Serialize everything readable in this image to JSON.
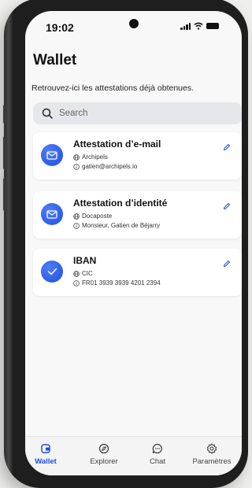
{
  "status_bar": {
    "time": "19:02"
  },
  "header": {
    "title": "Wallet",
    "subtitle": "Retrouvez-ici les attestations déjà obtenues."
  },
  "search": {
    "placeholder": "Search"
  },
  "cards": [
    {
      "title": "Attestation d’e-mail",
      "issuer": "Archipels",
      "detail": "gatien@archipels.io",
      "icon": "mail-icon"
    },
    {
      "title": "Attestation d’identité",
      "issuer": "Docaposte",
      "detail": "Monsieur, Gatien de Béjarry",
      "icon": "mail-icon"
    },
    {
      "title": "IBAN",
      "issuer": "CIC",
      "detail": "FR01 3939 3939 4201 2394",
      "icon": "check-icon"
    }
  ],
  "tabs": [
    {
      "label": "Wallet",
      "icon": "wallet-icon",
      "active": true
    },
    {
      "label": "Explorer",
      "icon": "compass-icon",
      "active": false
    },
    {
      "label": "Chat",
      "icon": "chat-icon",
      "active": false
    },
    {
      "label": "Paramètres",
      "icon": "gear-icon",
      "active": false
    }
  ],
  "colors": {
    "accent": "#1f4fe0",
    "background": "#f8f8f8",
    "card": "#ffffff"
  }
}
